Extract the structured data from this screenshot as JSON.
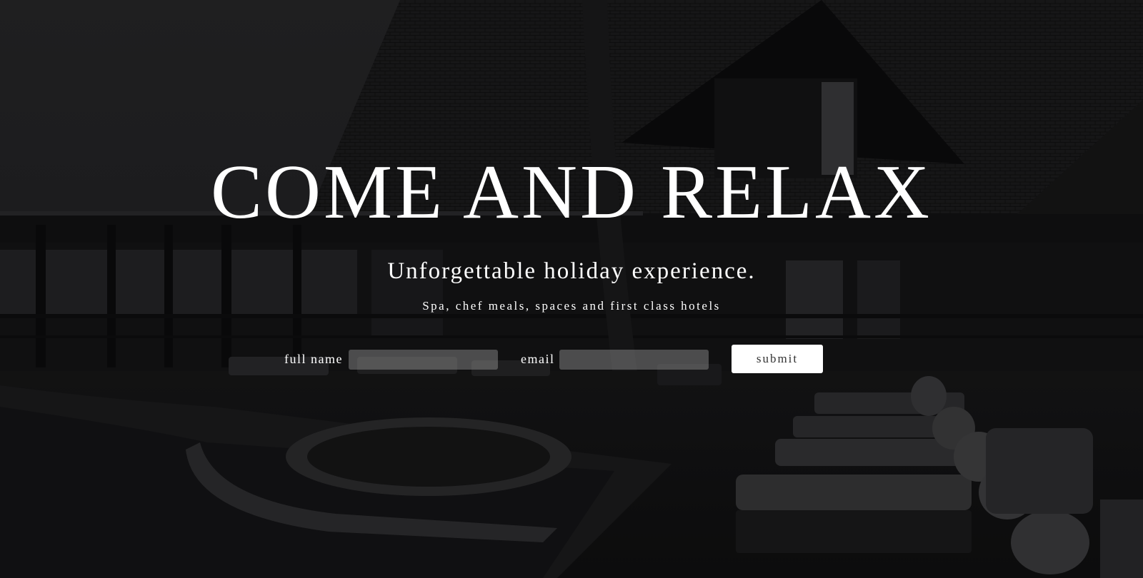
{
  "hero": {
    "title": "COME AND RELAX",
    "subtitle": "Unforgettable holiday experience.",
    "tagline": "Spa, chef meals, spaces and first class hotels"
  },
  "form": {
    "full_name_label": "full name",
    "full_name_value": "",
    "email_label": "email",
    "email_value": "",
    "submit_label": "submit"
  },
  "colors": {
    "text": "#ffffff",
    "input_bg": "rgba(150,150,150,0.45)",
    "button_bg": "#ffffff",
    "button_text": "#333333",
    "background": "#0d0d0e"
  }
}
